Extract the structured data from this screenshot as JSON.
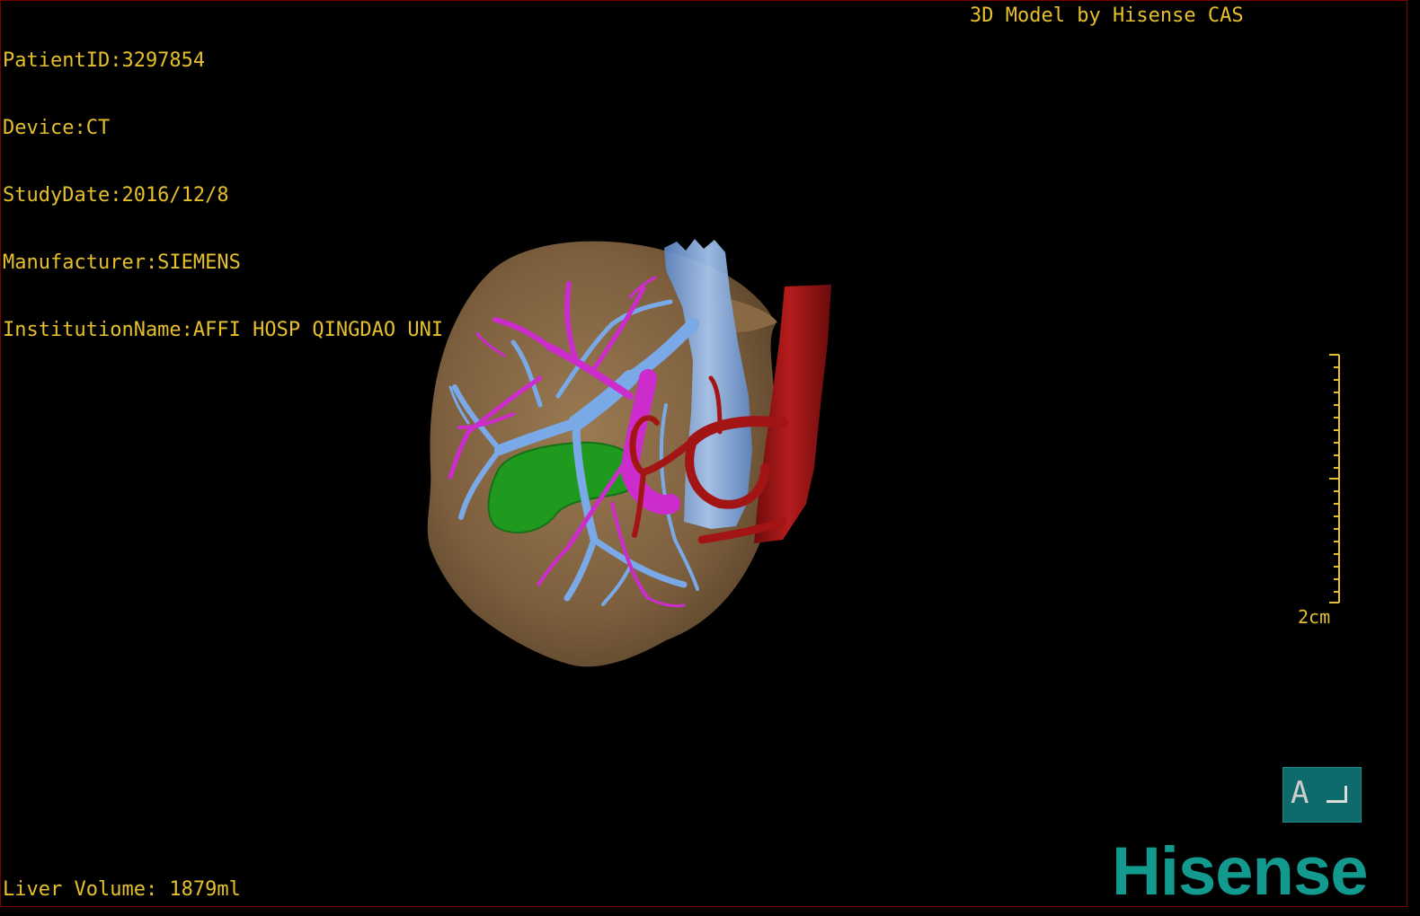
{
  "dicom_info": {
    "patient_id": "PatientID:3297854",
    "device": "Device:CT",
    "study_date": "StudyDate:2016/12/8",
    "manufacturer": "Manufacturer:SIEMENS",
    "institution": "InstitutionName:AFFI HOSP QINGDAO UNI"
  },
  "model_credit": "3D Model by Hisense CAS",
  "scale_bar": {
    "label": "2cm"
  },
  "liver_volume": "Liver Volume: 1879ml",
  "orientation_marker": {
    "letter": "A"
  },
  "brand_logo": "Hisense",
  "colors": {
    "overlay_text": "#e6c02c",
    "liver": "#8b6a45",
    "portal_vein": "#7aa9e8",
    "hepatic_vein": "#cc2ccc",
    "artery": "#a31515",
    "gallbladder": "#1f9a1f",
    "brand": "#129a8f",
    "orientation_box": "#0f6b6b"
  },
  "icons": {
    "orientation": "orientation-cube-icon",
    "logo": "hisense-logo"
  }
}
